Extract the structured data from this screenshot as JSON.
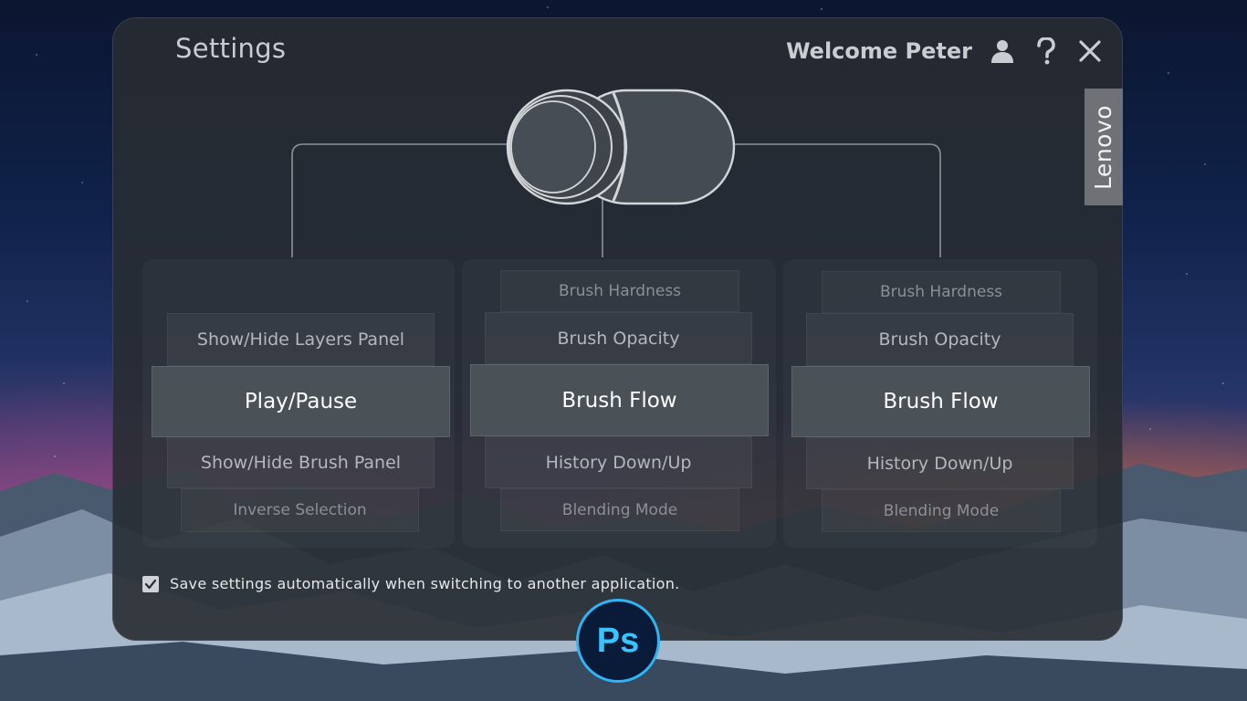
{
  "header": {
    "title": "Settings",
    "welcome": "Welcome Peter",
    "brand": "Lenovo",
    "icons": [
      "user-icon",
      "help-icon",
      "close-icon"
    ]
  },
  "groups": [
    {
      "name": "left",
      "top_far": "",
      "top_near": "Show/Hide Layers Panel",
      "selected": "Play/Pause",
      "bottom_near": "Show/Hide Brush Panel",
      "bottom_far": "Inverse Selection"
    },
    {
      "name": "center",
      "top_far": "Brush Hardness",
      "top_near": "Brush Opacity",
      "selected": "Brush Flow",
      "bottom_near": "History Down/Up",
      "bottom_far": "Blending Mode"
    },
    {
      "name": "right",
      "top_far": "Brush Hardness",
      "top_near": "Brush Opacity",
      "selected": "Brush Flow",
      "bottom_near": "History Down/Up",
      "bottom_far": "Blending Mode"
    }
  ],
  "footer": {
    "save_checked": true,
    "save_label": "Save settings automatically when switching to another application.",
    "app_badge": "Ps"
  },
  "colors": {
    "panel_bg": "#282c32",
    "selected_bg": "#4a5157",
    "ps_accent": "#2fb5f5"
  }
}
